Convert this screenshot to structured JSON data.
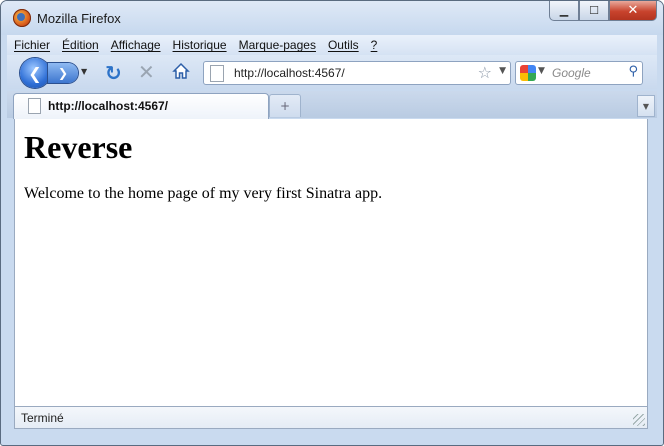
{
  "window": {
    "title": "Mozilla Firefox",
    "buttons": {
      "minimize": "▁",
      "maximize": "☐",
      "close": "✕"
    }
  },
  "menu": [
    "Fichier",
    "Édition",
    "Affichage",
    "Historique",
    "Marque-pages",
    "Outils",
    "?"
  ],
  "navigation": {
    "url": "http://localhost:4567/",
    "search_placeholder": "Google"
  },
  "tabs": [
    {
      "label": "http://localhost:4567/",
      "active": true
    }
  ],
  "page": {
    "heading": "Reverse",
    "body": "Welcome to the home page of my very first Sinatra app."
  },
  "status": {
    "text": "Terminé"
  },
  "colors": {
    "chrome": "#c9daef",
    "accent": "#2f6fd6",
    "close": "#c8432d"
  }
}
